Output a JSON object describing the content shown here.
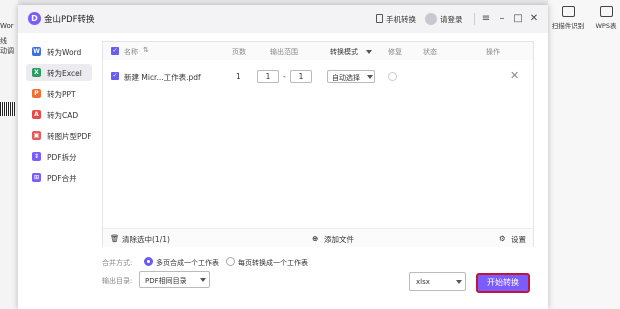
{
  "background_app": {
    "left_labels": [
      "Wor",
      "线",
      "动调"
    ],
    "right_tools": [
      "扫描件识别",
      "WPS表"
    ]
  },
  "titlebar": {
    "logo_letter": "D",
    "title": "金山PDF转换",
    "phone_convert": "手机转换",
    "login": "请登录"
  },
  "sidebar": {
    "items": [
      {
        "label": "转为Word",
        "color": "#3b6fe6",
        "glyph": "W"
      },
      {
        "label": "转为Excel",
        "color": "#2a9e5f",
        "glyph": "X"
      },
      {
        "label": "转为PPT",
        "color": "#f07033",
        "glyph": "P"
      },
      {
        "label": "转为CAD",
        "color": "#e84a4a",
        "glyph": "A"
      },
      {
        "label": "转图片型PDF",
        "color": "#e85a5a",
        "glyph": "▣"
      },
      {
        "label": "PDF拆分",
        "color": "#7b5cff",
        "glyph": "⇕"
      },
      {
        "label": "PDF合并",
        "color": "#7b5cff",
        "glyph": "⊞"
      }
    ]
  },
  "table": {
    "headers": {
      "name": "名称",
      "pages": "页数",
      "range": "输出范围",
      "mode": "转换模式",
      "repair": "修复",
      "status": "状态",
      "action": "操作"
    },
    "rows": [
      {
        "name": "新建 Micr...工作表.pdf",
        "pages": "1",
        "range_from": "1",
        "range_to": "1",
        "range_sep": "-",
        "mode": "自动选择"
      }
    ],
    "footer": {
      "clear": "清除选中(1/1)",
      "add": "添加文件",
      "settings": "设置"
    }
  },
  "options": {
    "merge_label": "合并方式:",
    "merge_opt1": "多页合成一个工作表",
    "merge_opt2": "每页转换成一个工作表",
    "output_label": "输出目录:",
    "output_value": "PDF相同目录",
    "format_value": "xlsx",
    "convert_button": "开始转换"
  },
  "colors": {
    "accent": "#7b5cff",
    "highlight_border": "#c0163a"
  }
}
